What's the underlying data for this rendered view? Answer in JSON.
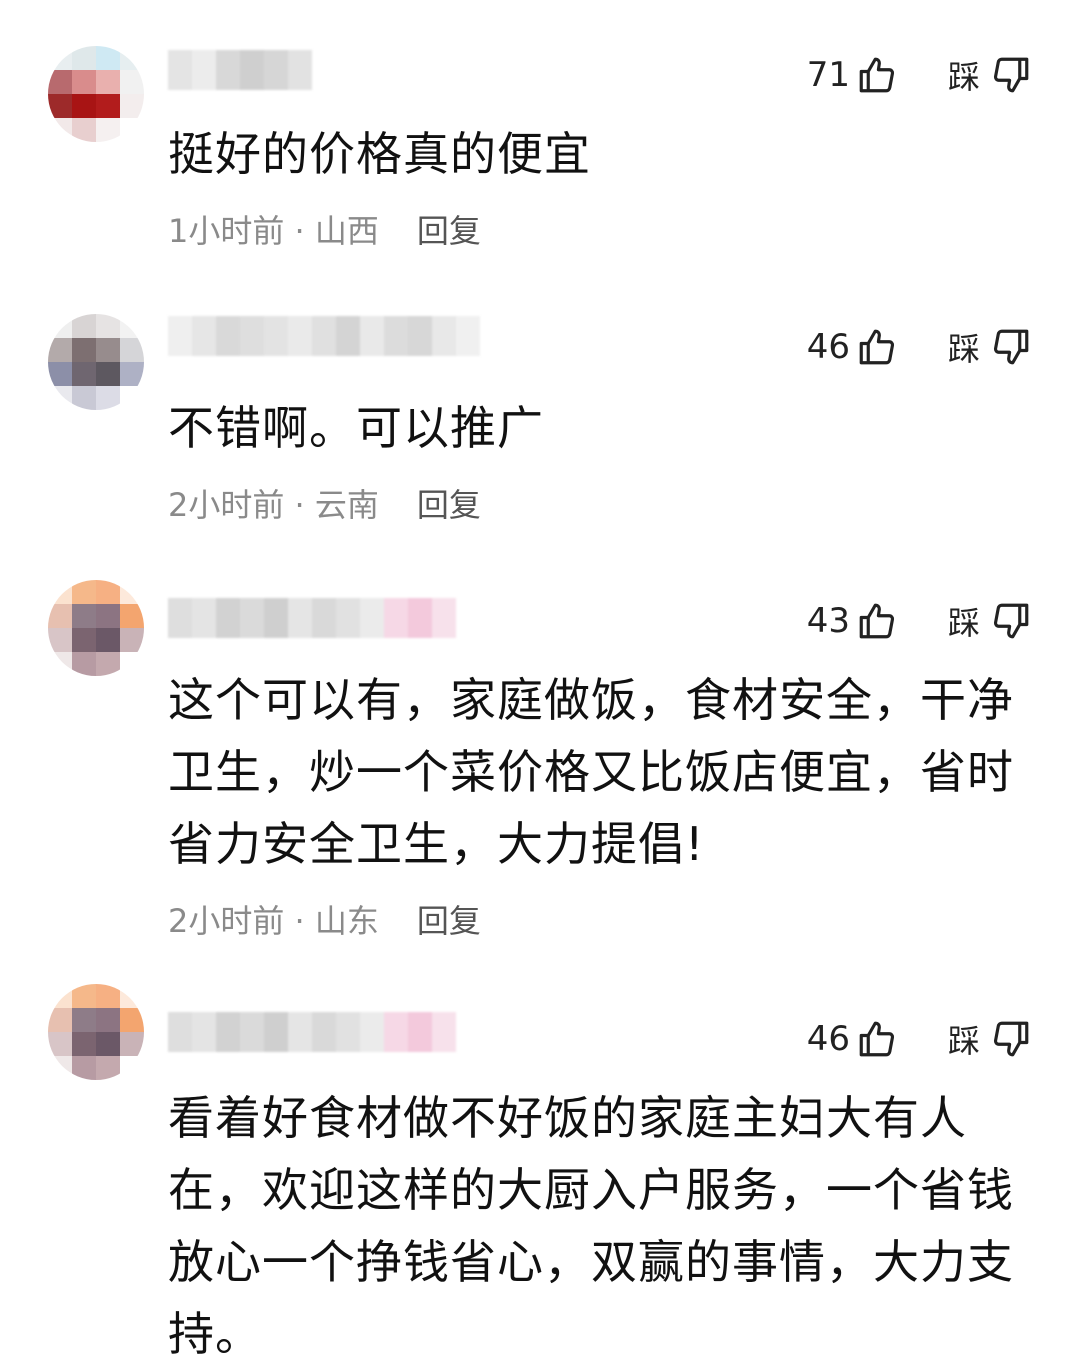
{
  "icons": {
    "like": "thumb-up-icon",
    "dislike": "thumb-down-icon"
  },
  "dislike_label": "踩",
  "reply_label": "回复",
  "comments": [
    {
      "likes": "71",
      "text": "挺好的价格真的便宜",
      "meta": "1小时前 · 山西"
    },
    {
      "likes": "46",
      "text": "不错啊。可以推广",
      "meta": "2小时前 · 云南"
    },
    {
      "likes": "43",
      "text": "这个可以有，家庭做饭，食材安全，干净卫生，炒一个菜价格又比饭店便宜，省时省力安全卫生，大力提倡!",
      "meta": "2小时前 · 山东"
    },
    {
      "likes": "46",
      "text": "看着好食材做不好饭的家庭主妇大有人在，欢迎这样的大厨入户服务，一个省钱放心一个挣钱省心，双赢的事情，大力支持。",
      "meta": ""
    }
  ]
}
